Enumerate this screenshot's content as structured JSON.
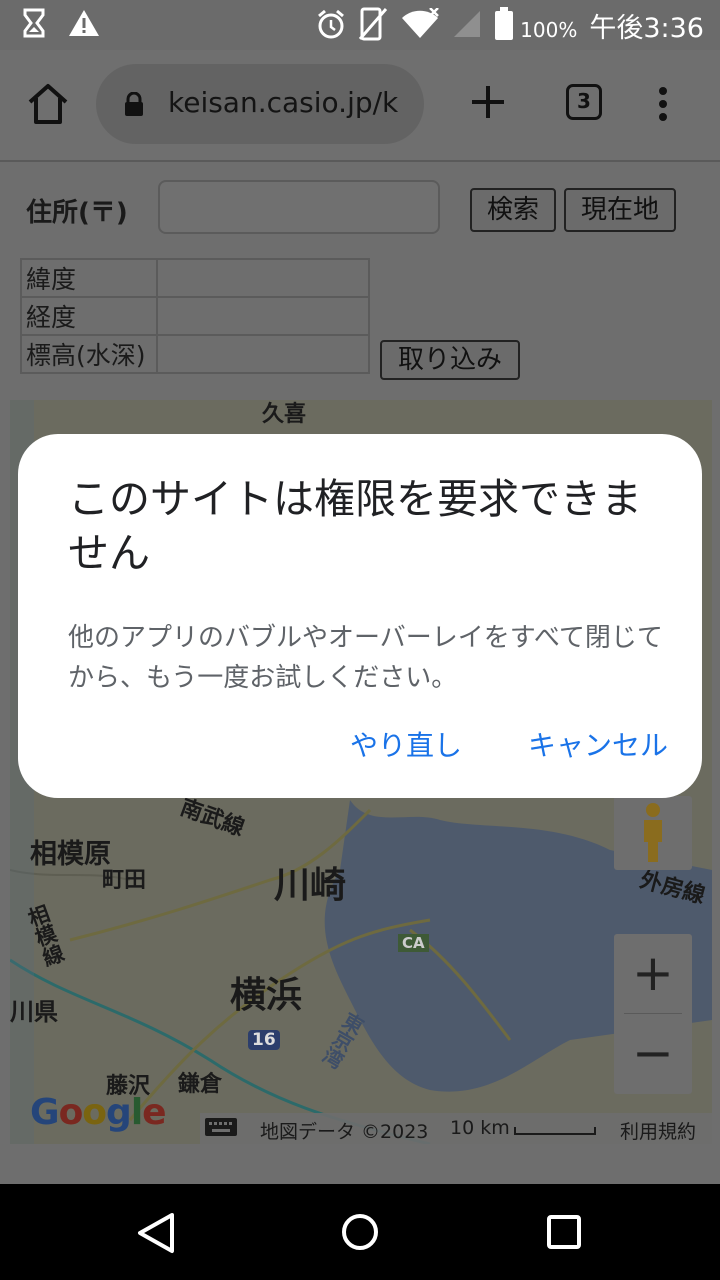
{
  "status_bar": {
    "icons_left": [
      "hourglass-icon",
      "warning-icon"
    ],
    "icons_right": [
      "alarm-icon",
      "vibrate-icon",
      "wifi-icon",
      "signal-icon",
      "battery-icon"
    ],
    "battery_percent": "100%",
    "time": "午後3:36"
  },
  "toolbar": {
    "url": "keisan.casio.jp/k",
    "tab_count": "3"
  },
  "page": {
    "address_label": "住所(〒)",
    "address_value": "",
    "search_button": "検索",
    "location_button": "現在地",
    "rows": [
      {
        "label": "緯度",
        "value": ""
      },
      {
        "label": "経度",
        "value": ""
      },
      {
        "label": "標高(水深)",
        "value": ""
      }
    ],
    "import_button": "取り込み"
  },
  "map": {
    "labels": {
      "kuki": "久喜",
      "sagamihara": "相模原",
      "machida": "町田",
      "kawasaki": "川崎",
      "yokohama": "横浜",
      "fujisawa": "藤沢",
      "kamakura": "鎌倉",
      "kanagawa": "川県",
      "nanbu_line": "南武線",
      "sagami_line": "相模線",
      "sotobo_line": "外房線",
      "tokyo_bay": "東京湾",
      "route_16": "16",
      "ca": "CA"
    },
    "zoom_in": "+",
    "zoom_out": "−",
    "footer": {
      "map_data": "地図データ ©2023",
      "scale": "10 km",
      "terms": "利用規約"
    },
    "logo": "Google"
  },
  "dialog": {
    "title": "このサイトは権限を要求できません",
    "body": "他のアプリのバブルやオーバーレイをすべて閉じてから、もう一度お試しください。",
    "retry_button": "やり直し",
    "cancel_button": "キャンセル"
  },
  "nav_bar": {
    "icons": [
      "back-icon",
      "home-circle-icon",
      "recents-icon"
    ]
  },
  "colors": {
    "accent": "#1a73e8",
    "scrim": "#6e6e6e"
  }
}
